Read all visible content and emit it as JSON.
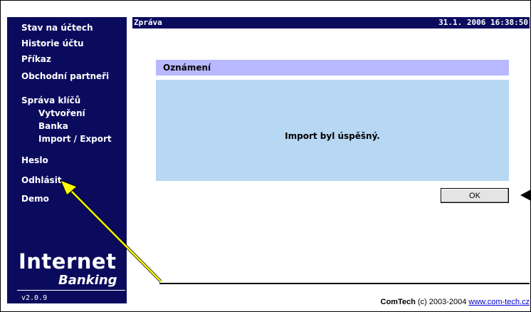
{
  "sidebar": {
    "items": [
      {
        "label": "Stav na účtech"
      },
      {
        "label": "Historie účtu"
      },
      {
        "label": "Příkaz"
      },
      {
        "label": "Obchodní partneři"
      },
      {
        "label": "Správa klíčů"
      },
      {
        "label": "Vytvoření"
      },
      {
        "label": "Banka"
      },
      {
        "label": "Import / Export"
      },
      {
        "label": "Heslo"
      },
      {
        "label": "Odhlásit"
      },
      {
        "label": "Demo"
      }
    ],
    "brand_title": "Internet",
    "brand_subtitle": "Banking",
    "version": "v2.0.9"
  },
  "header": {
    "title": "Zpráva",
    "datetime": "31.1. 2006  16:38:50"
  },
  "dialog": {
    "heading": "Oznámení",
    "message": "Import byl úspěšný.",
    "ok_label": "OK"
  },
  "footer": {
    "company": "ComTech",
    "copyright": " (c) 2003-2004 ",
    "link": "www.com-tech.cz"
  },
  "colors": {
    "sidebar_bg": "#0b0b5e",
    "panel_head": "#b8b8ff",
    "panel_body": "#b7d7f3",
    "annotation_arrow": "#ffff00"
  }
}
